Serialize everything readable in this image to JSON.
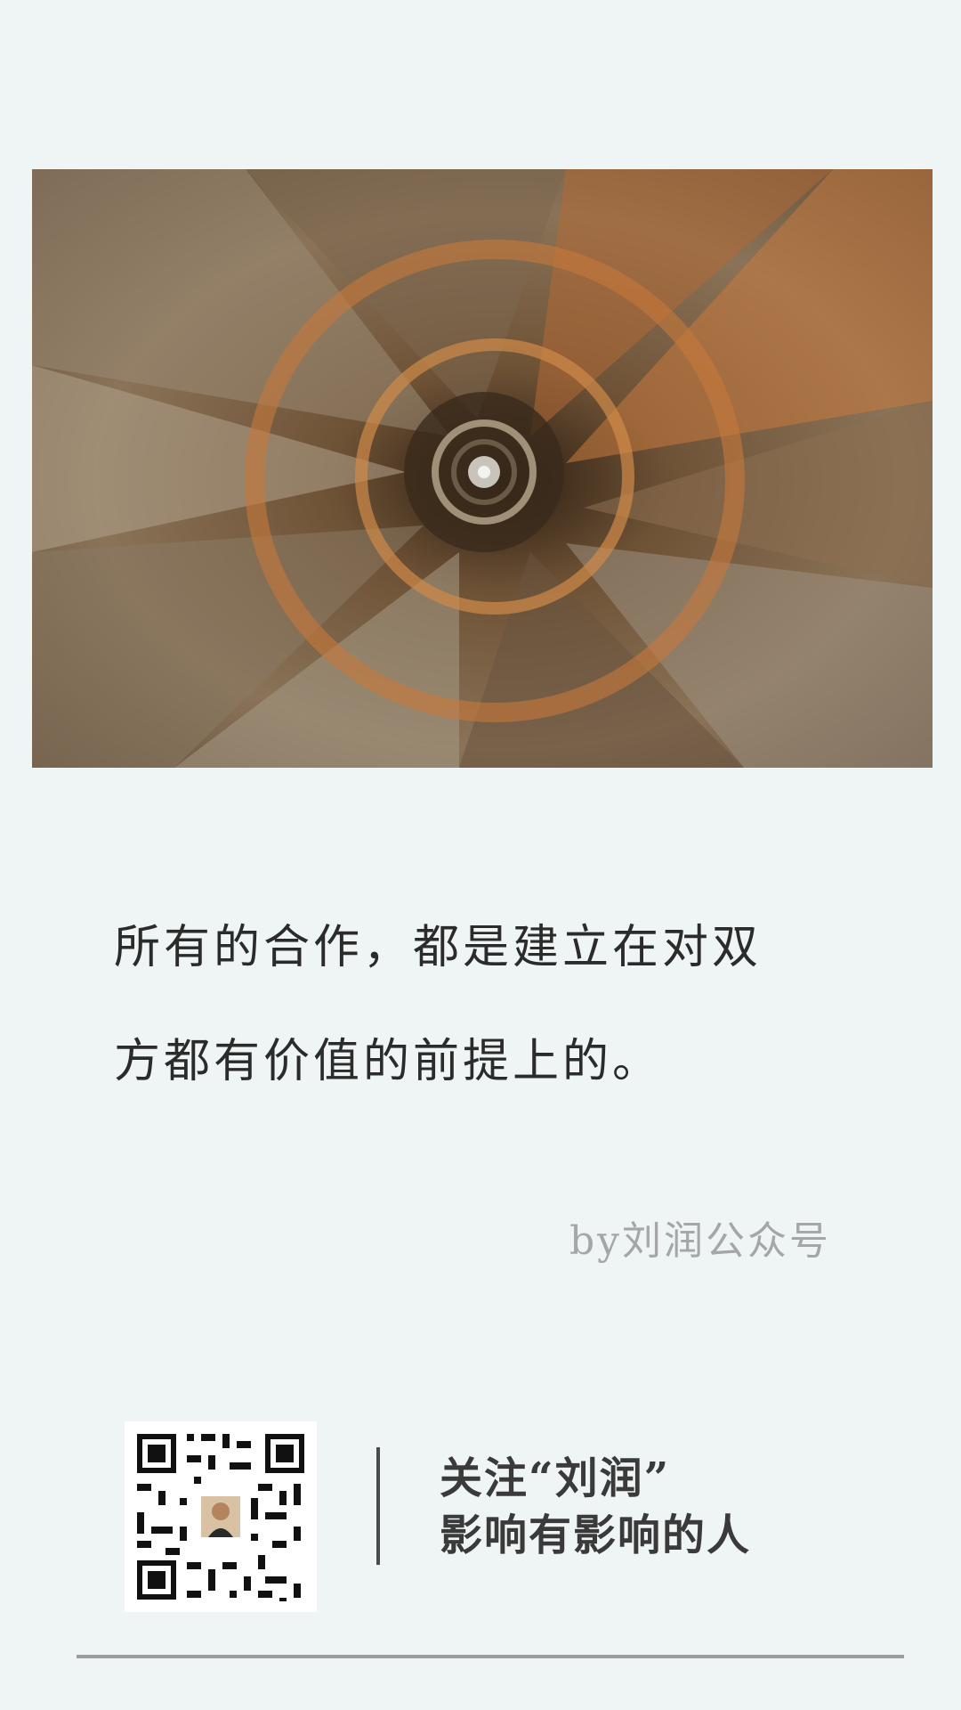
{
  "photo": {
    "subject": "spiral staircase",
    "colors": {
      "shadow": "#3a2a1c",
      "stone": "#8a7358",
      "warm": "#c8783a"
    }
  },
  "quote": {
    "line1": "所有的合作，都是建立在对双",
    "line2": "方都有价值的前提上的。"
  },
  "byline": "by刘润公众号",
  "footer": {
    "follow_line1": "关注“刘润”",
    "follow_line2": "影响有影响的人"
  },
  "colors": {
    "background": "#eff4f5",
    "text": "#2b2b2b",
    "muted": "#a4a6a8"
  }
}
